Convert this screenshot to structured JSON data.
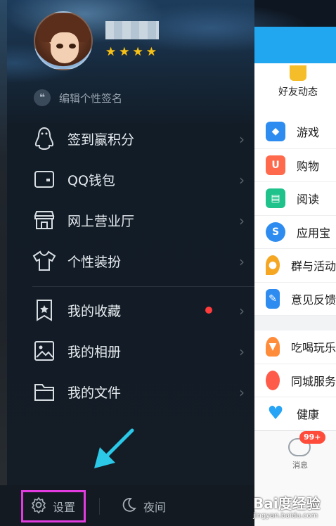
{
  "profile": {
    "nickname": "",
    "stars": [
      "★",
      "★",
      "★",
      "★"
    ]
  },
  "signature": {
    "quote_glyph": "❝",
    "placeholder": "编辑个性签名"
  },
  "menu": {
    "group1": [
      {
        "label": "签到赢积分",
        "icon": "penguin-icon"
      },
      {
        "label": "QQ钱包",
        "icon": "wallet-icon"
      },
      {
        "label": "网上营业厅",
        "icon": "store-icon"
      },
      {
        "label": "个性装扮",
        "icon": "tshirt-icon"
      }
    ],
    "group2": [
      {
        "label": "我的收藏",
        "icon": "favorites-icon",
        "has_dot": true
      },
      {
        "label": "我的相册",
        "icon": "photo-album-icon"
      },
      {
        "label": "我的文件",
        "icon": "folder-icon"
      }
    ],
    "chevron": "›"
  },
  "bottom": {
    "settings_label": "设置",
    "night_label": "夜间"
  },
  "panel": {
    "friend_feed": "好友动态",
    "features_a": [
      {
        "label": "游戏",
        "color": "#2e8cf0",
        "icon": "gamepad-icon"
      },
      {
        "label": "购物",
        "color": "#ff6a4d",
        "icon": "shopping-icon"
      },
      {
        "label": "阅读",
        "color": "#1fc28a",
        "icon": "book-icon"
      },
      {
        "label": "应用宝",
        "color": "#2e8cf0",
        "icon": "app-store-icon"
      },
      {
        "label": "群与活动",
        "color": "#f5a623",
        "icon": "location-icon"
      },
      {
        "label": "意见反馈",
        "color": "#2e8cf0",
        "icon": "feedback-icon"
      }
    ],
    "features_b": [
      {
        "label": "吃喝玩乐",
        "color": "#ff8c3a",
        "icon": "food-icon"
      },
      {
        "label": "同城服务",
        "color": "#ff5b4a",
        "icon": "balloon-icon"
      },
      {
        "label": "健康",
        "color": "#27a4f5",
        "icon": "heart-icon"
      }
    ],
    "message_badge": "99+",
    "message_label": "消息"
  },
  "watermark": {
    "brand": "Bai度经验",
    "url": "jingyan.baidu.com"
  },
  "colors": {
    "accent": "#21a7f0",
    "highlight_box": "#e23be0",
    "arrow": "#2bc8e8",
    "notification_dot": "#ff3b3b"
  }
}
